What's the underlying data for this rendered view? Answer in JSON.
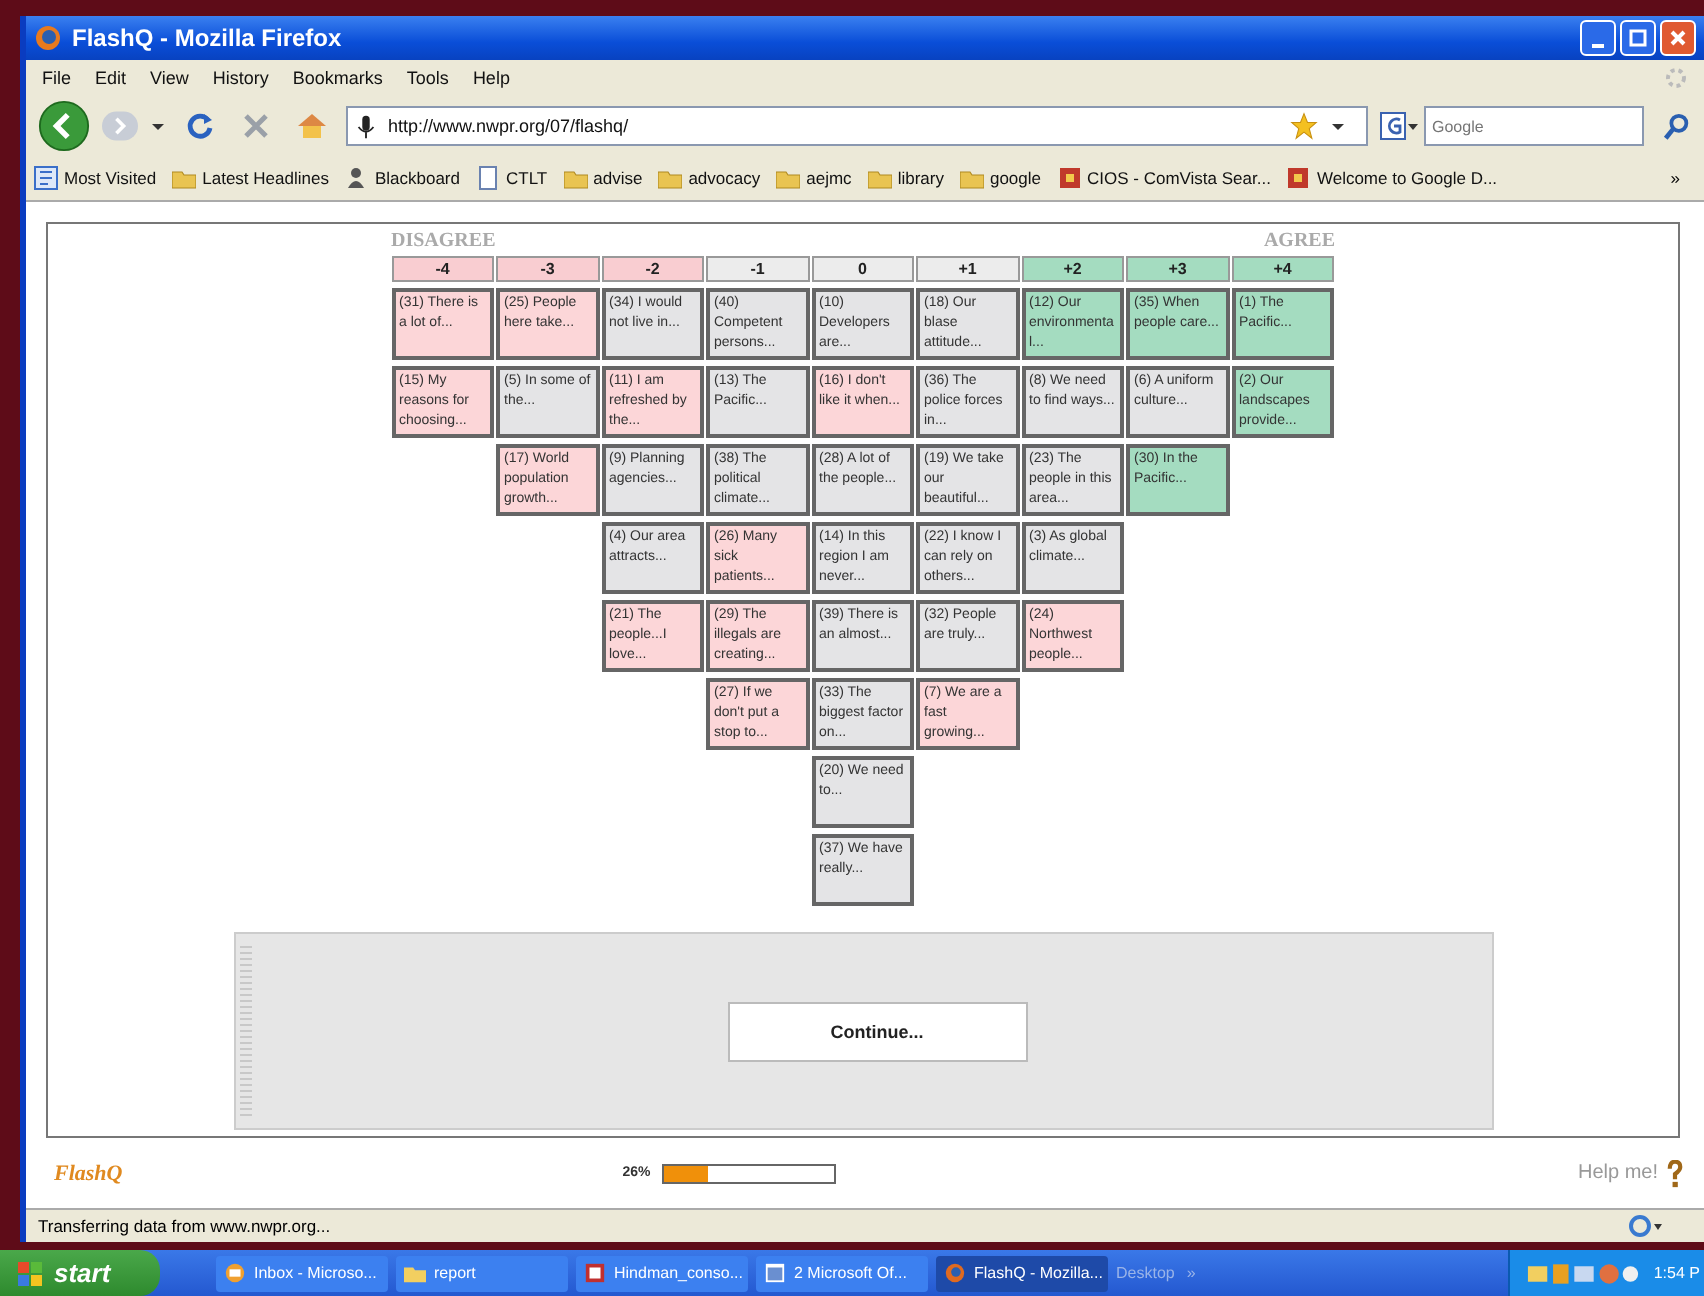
{
  "window": {
    "title": "FlashQ - Mozilla Firefox"
  },
  "menu": [
    "File",
    "Edit",
    "View",
    "History",
    "Bookmarks",
    "Tools",
    "Help"
  ],
  "address": {
    "value": "http://www.nwpr.org/07/flashq/"
  },
  "search": {
    "placeholder": "Google"
  },
  "bookmarks": [
    {
      "label": "Most Visited",
      "kind": "feed"
    },
    {
      "label": "Latest Headlines",
      "kind": "folder"
    },
    {
      "label": "Blackboard",
      "kind": "person"
    },
    {
      "label": "CTLT",
      "kind": "page"
    },
    {
      "label": "advise",
      "kind": "folder"
    },
    {
      "label": "advocacy",
      "kind": "folder"
    },
    {
      "label": "aejmc",
      "kind": "folder"
    },
    {
      "label": "library",
      "kind": "folder"
    },
    {
      "label": "google",
      "kind": "folder"
    },
    {
      "label": "CIOS - ComVista Sear...",
      "kind": "app"
    },
    {
      "label": "Welcome to Google D...",
      "kind": "app"
    }
  ],
  "bookmarks_more": "»",
  "scale": {
    "left_label": "DISAGREE",
    "right_label": "AGREE"
  },
  "columns": [
    {
      "label": "-4",
      "color": "#f9cdd1",
      "cards": [
        {
          "text": "(31) There is a lot of...",
          "color": "#fcd6d8"
        },
        {
          "text": "(15) My reasons for choosing...",
          "color": "#fcd6d8"
        }
      ]
    },
    {
      "label": "-3",
      "color": "#f9cdd1",
      "cards": [
        {
          "text": "(25) People here take...",
          "color": "#fcd6d8"
        },
        {
          "text": "(5) In some of the...",
          "color": "#e4e4e6"
        },
        {
          "text": "(17) World population growth...",
          "color": "#fcd6d8"
        }
      ]
    },
    {
      "label": "-2",
      "color": "#f9cdd1",
      "cards": [
        {
          "text": "(34) I would not live in...",
          "color": "#e4e4e6"
        },
        {
          "text": "(11) I am refreshed by the...",
          "color": "#fcd6d8"
        },
        {
          "text": "(9) Planning agencies...",
          "color": "#e4e4e6"
        },
        {
          "text": "(4) Our area attracts...",
          "color": "#e4e4e6"
        },
        {
          "text": "(21) The people...I love...",
          "color": "#fcd6d8"
        }
      ]
    },
    {
      "label": "-1",
      "color": "#ececec",
      "cards": [
        {
          "text": "(40) Competent persons...",
          "color": "#e4e4e6"
        },
        {
          "text": "(13) The Pacific...",
          "color": "#e4e4e6"
        },
        {
          "text": "(38) The political climate...",
          "color": "#e4e4e6"
        },
        {
          "text": "(26) Many sick patients...",
          "color": "#fcd6d8"
        },
        {
          "text": "(29) The illegals are creating...",
          "color": "#fcd6d8"
        },
        {
          "text": "(27) If we don't put a stop to...",
          "color": "#fcd6d8"
        }
      ]
    },
    {
      "label": "0",
      "color": "#ececec",
      "cards": [
        {
          "text": "(10) Developers are...",
          "color": "#e4e4e6"
        },
        {
          "text": "(16) I don't like it when...",
          "color": "#fcd6d8"
        },
        {
          "text": "(28) A lot of the people...",
          "color": "#e4e4e6"
        },
        {
          "text": "(14) In this region I am never...",
          "color": "#e4e4e6"
        },
        {
          "text": "(39) There is an almost...",
          "color": "#e4e4e6"
        },
        {
          "text": "(33) The biggest factor on...",
          "color": "#e4e4e6"
        },
        {
          "text": "(20) We need to...",
          "color": "#e4e4e6"
        },
        {
          "text": "(37) We have really...",
          "color": "#e4e4e6"
        }
      ]
    },
    {
      "label": "+1",
      "color": "#ececec",
      "cards": [
        {
          "text": "(18) Our blase attitude...",
          "color": "#e4e4e6"
        },
        {
          "text": "(36) The police forces in...",
          "color": "#e4e4e6"
        },
        {
          "text": "(19) We take our beautiful...",
          "color": "#e4e4e6"
        },
        {
          "text": "(22) I know I can rely on others...",
          "color": "#e4e4e6"
        },
        {
          "text": "(32) People are truly...",
          "color": "#e4e4e6"
        },
        {
          "text": "(7) We are a fast growing...",
          "color": "#fcd6d8"
        }
      ]
    },
    {
      "label": "+2",
      "color": "#a4dcc0",
      "cards": [
        {
          "text": "(12) Our environmental...",
          "color": "#a4dcc0"
        },
        {
          "text": "(8) We need to find ways...",
          "color": "#e4e4e6"
        },
        {
          "text": "(23) The people in this area...",
          "color": "#e4e4e6"
        },
        {
          "text": "(3) As global climate...",
          "color": "#e4e4e6"
        },
        {
          "text": "(24) Northwest people...",
          "color": "#fcd6d8"
        }
      ]
    },
    {
      "label": "+3",
      "color": "#a4dcc0",
      "cards": [
        {
          "text": "(35) When people care...",
          "color": "#a4dcc0"
        },
        {
          "text": "(6) A uniform culture...",
          "color": "#e4e4e6"
        },
        {
          "text": "(30) In the Pacific...",
          "color": "#a4dcc0"
        }
      ]
    },
    {
      "label": "+4",
      "color": "#a4dcc0",
      "cards": [
        {
          "text": "(1) The Pacific...",
          "color": "#a4dcc0"
        },
        {
          "text": "(2) Our landscapes provide...",
          "color": "#a4dcc0"
        }
      ]
    }
  ],
  "continue_button": "Continue...",
  "footer": {
    "logo": "FlashQ",
    "progress_label": "26%",
    "level": 0.26,
    "help": "Help me!"
  },
  "status_bar": "Transferring data from www.nwpr.org...",
  "taskbar": {
    "start": "start",
    "items": [
      {
        "label": "Inbox - Microso...",
        "kind": "mail",
        "selected": false
      },
      {
        "label": "report",
        "kind": "folder",
        "selected": false
      },
      {
        "label": "Hindman_conso...",
        "kind": "doc",
        "selected": false
      },
      {
        "label": "2 Microsoft Of...",
        "kind": "window",
        "selected": false
      },
      {
        "label": "FlashQ - Mozilla...",
        "kind": "browser",
        "selected": true
      }
    ],
    "desktop": "Desktop",
    "more": "»",
    "clock": "1:54 P"
  }
}
